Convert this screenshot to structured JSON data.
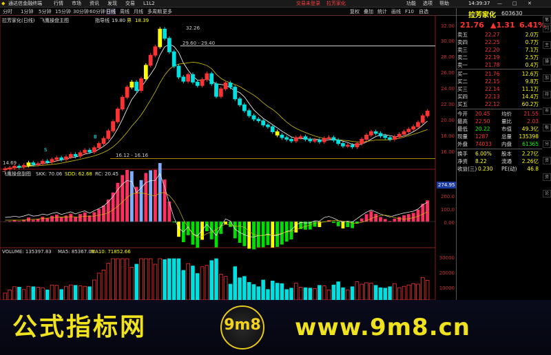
{
  "app": {
    "title": "通达信金融终端",
    "menus": [
      "行情",
      "市场",
      "资讯",
      "发现",
      "交易",
      "L1L2"
    ],
    "status": [
      "交易未登录",
      "拉芳家化"
    ],
    "right_menus": [
      "功能",
      "选项",
      "帮助"
    ],
    "clock": "14:39:37"
  },
  "toolbar": {
    "periods": [
      "分时",
      "1分钟",
      "5分钟",
      "15分钟",
      "30分钟",
      "60分钟",
      "日线",
      "周线",
      "月线",
      "多周期",
      "更多"
    ],
    "active": "日线",
    "right": [
      "复权",
      "叠加",
      "统计",
      "画线",
      "F10",
      "自选"
    ]
  },
  "main_panel": {
    "name": "拉芳家化(日线)",
    "indicator": "飞鹰操盘主图",
    "label1": "指导线",
    "value1": "19.80",
    "label2": "界",
    "value2": "18.39",
    "annotations": [
      "32.26",
      "29.60 - 29.40",
      "16.12 - 16.16",
      "14.69",
      "S",
      "B"
    ]
  },
  "sub_panel": {
    "name": "飞鹰操盘副图",
    "skk": "SKK: 70.06",
    "sdd": "SDD: 62.68",
    "rc": "RC: 20.45",
    "badge": "274.95"
  },
  "vol_panel": {
    "name": "VOLUME: 135397.83",
    "ma5": "MA5: 85367.01",
    "ma10": "MA10: 71852.66"
  },
  "axes": {
    "main": [
      "32.00",
      "30.00",
      "28.00",
      "26.00",
      "24.00",
      "22.00",
      "20.00",
      "18.00",
      "16.00"
    ],
    "sub": [
      "200.0",
      "100.0",
      "0.00"
    ],
    "vol": [
      "30000",
      "20000",
      "10000"
    ]
  },
  "quote": {
    "name": "拉芳家化",
    "code": "603630",
    "price": "21.76",
    "change": "▲1.31",
    "pct": "6.41%",
    "asks": [
      [
        "卖五",
        "22.27",
        "2.0万"
      ],
      [
        "卖四",
        "22.25",
        "0.7万"
      ],
      [
        "卖三",
        "22.20",
        "7.1万"
      ],
      [
        "卖二",
        "22.19",
        "2.5万"
      ],
      [
        "卖一",
        "21.78",
        "0.4万"
      ]
    ],
    "bids": [
      [
        "买一",
        "21.76",
        "12.6万"
      ],
      [
        "买二",
        "22.15",
        "9.8万"
      ],
      [
        "买三",
        "22.14",
        "11.1万"
      ],
      [
        "买四",
        "22.13",
        "14.4万"
      ],
      [
        "买五",
        "22.12",
        "60.2万"
      ]
    ],
    "stats": [
      [
        "今开",
        "20.45",
        "均价",
        "21.55"
      ],
      [
        "最高",
        "22.50",
        "量比",
        "2.03"
      ],
      [
        "最低",
        "20.22",
        "市值",
        "49.3亿"
      ],
      [
        "现量",
        "1287",
        "总量",
        "135398"
      ],
      [
        "外盘",
        "74033",
        "内盘",
        "61365"
      ]
    ],
    "stats2": [
      [
        "换手",
        "6.00%",
        "股本",
        "2.27亿"
      ],
      [
        "净资",
        "8.22",
        "流通",
        "2.26亿"
      ],
      [
        "收益(三)",
        "0.230",
        "PE(动)",
        "46.8"
      ]
    ]
  },
  "side_tabs": [
    "笔",
    "闪",
    "主",
    "操",
    "加",
    "持",
    "市",
    "板",
    "分",
    "资",
    "资",
    "论"
  ],
  "watermark": {
    "left": "公式指标网",
    "right": "www.9m8.cn",
    "logo": "9m8"
  },
  "colors": {
    "up": "#ff3232",
    "down": "#00e0e0",
    "yellow": "#ffff00",
    "accent": "#f0e21c"
  },
  "chart_data": {
    "type": "candlestick",
    "ylim": [
      15,
      33
    ],
    "closes": [
      14.9,
      15.0,
      15.2,
      15.1,
      15.3,
      15.6,
      15.4,
      15.5,
      15.8,
      15.7,
      16.0,
      16.2,
      16.0,
      16.3,
      16.6,
      16.4,
      16.8,
      17.1,
      16.9,
      17.4,
      17.9,
      18.5,
      19.4,
      20.5,
      22.0,
      23.4,
      24.6,
      25.2,
      24.2,
      25.6,
      27.2,
      28.4,
      29.4,
      31.5,
      30.4,
      28.8,
      27.1,
      25.8,
      25.3,
      26.1,
      25.2,
      24.8,
      25.5,
      26.2,
      25.0,
      23.5,
      24.4,
      25.1,
      24.6,
      23.2,
      22.5,
      21.8,
      21.2,
      20.8,
      20.6,
      20.1,
      19.9,
      19.3,
      18.9,
      18.6,
      18.4,
      18.2,
      18.6,
      18.7,
      18.4,
      18.2,
      18.3,
      18.1,
      18.5,
      18.6,
      18.3,
      17.9,
      17.6,
      17.7,
      17.5,
      17.9,
      18.4,
      18.9,
      19.3,
      19.1,
      18.8,
      18.6,
      18.4,
      18.7,
      19.0,
      19.3,
      19.6,
      19.9,
      20.4,
      21.2,
      21.76
    ]
  }
}
